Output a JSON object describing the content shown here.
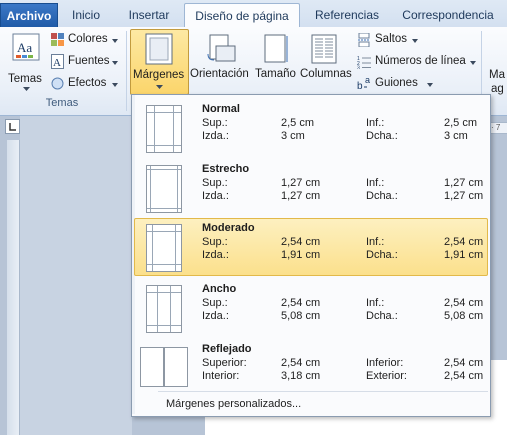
{
  "tabs": [
    {
      "label": "Archivo"
    },
    {
      "label": "Inicio"
    },
    {
      "label": "Insertar"
    },
    {
      "label": "Diseño de página"
    },
    {
      "label": "Referencias"
    },
    {
      "label": "Correspondencia"
    }
  ],
  "ribbon": {
    "temas": "Temas",
    "colores": "Colores",
    "fuentes": "Fuentes",
    "efectos": "Efectos",
    "temas_group": "Temas",
    "margenes": "Márgenes",
    "orientacion": "Orientación",
    "tamano": "Tamaño",
    "columnas": "Columnas",
    "saltos": "Saltos",
    "numeros_linea": "Números de línea",
    "guiones": "Guiones",
    "right_cut_top": "Ma",
    "right_cut_bottom": "ag"
  },
  "ruler": {
    "tick": "· 7"
  },
  "margins_menu": {
    "items": [
      {
        "name": "Normal",
        "l1": "Sup.:",
        "v1": "2,5 cm",
        "l2": "Inf.:",
        "v2": "2,5 cm",
        "l3": "Izda.:",
        "v3": "3 cm",
        "l4": "Dcha.:",
        "v4": "3 cm"
      },
      {
        "name": "Estrecho",
        "l1": "Sup.:",
        "v1": "1,27 cm",
        "l2": "Inf.:",
        "v2": "1,27 cm",
        "l3": "Izda.:",
        "v3": "1,27 cm",
        "l4": "Dcha.:",
        "v4": "1,27 cm"
      },
      {
        "name": "Moderado",
        "l1": "Sup.:",
        "v1": "2,54 cm",
        "l2": "Inf.:",
        "v2": "2,54 cm",
        "l3": "Izda.:",
        "v3": "1,91 cm",
        "l4": "Dcha.:",
        "v4": "1,91 cm"
      },
      {
        "name": "Ancho",
        "l1": "Sup.:",
        "v1": "2,54 cm",
        "l2": "Inf.:",
        "v2": "2,54 cm",
        "l3": "Izda.:",
        "v3": "5,08 cm",
        "l4": "Dcha.:",
        "v4": "5,08 cm"
      },
      {
        "name": "Reflejado",
        "l1": "Superior:",
        "v1": "2,54 cm",
        "l2": "Inferior:",
        "v2": "2,54 cm",
        "l3": "Interior:",
        "v3": "3,18 cm",
        "l4": "Exterior:",
        "v4": "2,54 cm"
      }
    ],
    "custom": "Márgenes personalizados..."
  },
  "colors": {
    "accent": "#fbd56b",
    "file_tab": "#2a66b4",
    "highlight": "#fbe08c"
  }
}
